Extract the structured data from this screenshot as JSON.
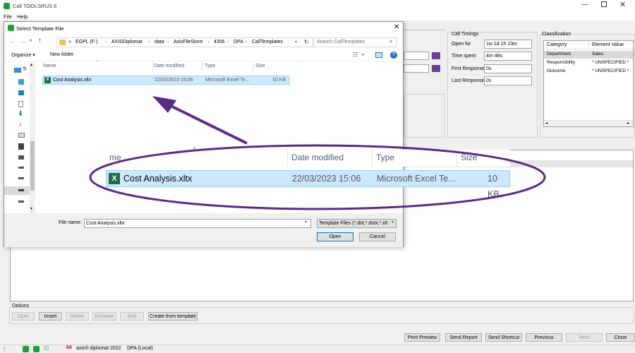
{
  "app": {
    "title": "Call TOOLSRUS 6",
    "menu": [
      "File",
      "Help"
    ]
  },
  "dialog": {
    "title": "Select Template File",
    "breadcrumb": [
      "«",
      "EGPL (F:)",
      "AXISDiplomat",
      "data",
      "AxisFileStore",
      "4356",
      "DPA",
      "CallTemplates"
    ],
    "search_placeholder": "Search CallTemplates",
    "organize_label": "Organize ▾",
    "new_folder_label": "New folder",
    "nav_first_label": "Ti",
    "columns": [
      "Name",
      "Date modified",
      "Type",
      "Size"
    ],
    "file": {
      "name": "Cost Analysis.xltx",
      "date": "22/03/2023 15:06",
      "type": "Microsoft Excel Te...",
      "size": "10 KB"
    },
    "filename_label": "File name:",
    "filename_value": "Cost Analysis.xltx",
    "filter_value": "Template Files (*.dot,*.dotx,*.xlt",
    "open_label": "Open",
    "cancel_label": "Cancel"
  },
  "zoom": {
    "name_header": "me",
    "date_header": "Date modified",
    "type_header": "Type",
    "size_header": "Size",
    "file_name": "Cost Analysis.xltx",
    "date": "22/03/2023 15:06",
    "type": "Microsoft Excel Te...",
    "size": "10 KB"
  },
  "call_timings": {
    "title": "Call Timings",
    "open_for_label": "Open for",
    "open_for_value": "1w 1d 1h 23m",
    "time_spent_label": "Time spent",
    "time_spent_value": "4m 48s",
    "first_response_label": "First Response",
    "first_response_value": "0s",
    "last_response_label": "Last Response",
    "last_response_value": "0s"
  },
  "classification": {
    "title": "Classification",
    "headers": [
      "Category",
      "Element Value"
    ],
    "rows": [
      {
        "category": "Department",
        "value": "Sales"
      },
      {
        "category": "Responsibility",
        "value": "* UNSPECIFIED *"
      },
      {
        "category": "Outcome",
        "value": "* UNSPECIFIED *"
      }
    ]
  },
  "options": {
    "title": "Options",
    "buttons": [
      {
        "label": "Open",
        "enabled": false
      },
      {
        "label": "Insert",
        "enabled": true
      },
      {
        "label": "Delete",
        "enabled": false
      },
      {
        "label": "Rename",
        "enabled": false
      },
      {
        "label": "Mail",
        "enabled": false
      },
      {
        "label": "Create from template",
        "enabled": true
      }
    ]
  },
  "footer_buttons": [
    {
      "label": "Print Preview",
      "enabled": true
    },
    {
      "label": "Send Report",
      "enabled": true
    },
    {
      "label": "Send Shortcut",
      "enabled": true
    },
    {
      "label": "Previous",
      "enabled": true
    },
    {
      "label": "Next",
      "enabled": false
    },
    {
      "label": "Close",
      "enabled": true
    }
  ],
  "taskbar": {
    "product": "axis® diplomat 2022",
    "db": "DPA (Local)"
  },
  "colors": {
    "accent_purple": "#5b2a86",
    "selection": "#cce8ff",
    "excel_green": "#1d6f42"
  }
}
